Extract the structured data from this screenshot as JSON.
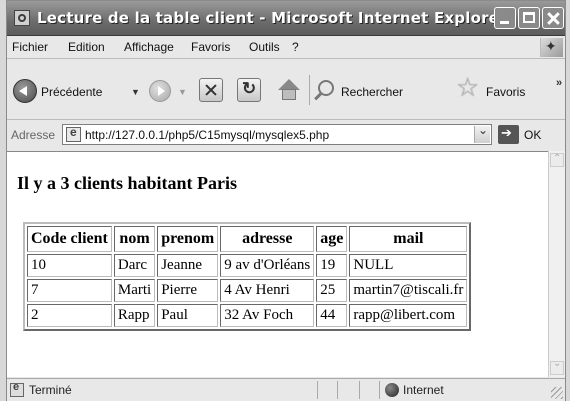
{
  "window": {
    "title": "Lecture de la table client - Microsoft Internet Explorer"
  },
  "menubar": {
    "items": [
      "Fichier",
      "Edition",
      "Affichage",
      "Favoris",
      "Outils",
      "?"
    ]
  },
  "toolbar": {
    "back_label": "Précédente",
    "search_label": "Rechercher",
    "favorites_label": "Favoris"
  },
  "address": {
    "label": "Adresse",
    "url": "http://127.0.0.1/php5/C15mysql/mysqlex5.php",
    "go_label": "OK"
  },
  "content": {
    "heading": "Il y a 3 clients habitant Paris",
    "table": {
      "headers": [
        "Code client",
        "nom",
        "prenom",
        "adresse",
        "age",
        "mail"
      ],
      "rows": [
        [
          "10",
          "Darc",
          "Jeanne",
          "9 av d'Orléans",
          "19",
          "NULL"
        ],
        [
          "7",
          "Marti",
          "Pierre",
          "4 Av Henri",
          "25",
          "martin7@tiscali.fr"
        ],
        [
          "2",
          "Rapp",
          "Paul",
          "32 Av Foch",
          "44",
          "rapp@libert.com"
        ]
      ]
    }
  },
  "status": {
    "text": "Terminé",
    "zone": "Internet"
  }
}
